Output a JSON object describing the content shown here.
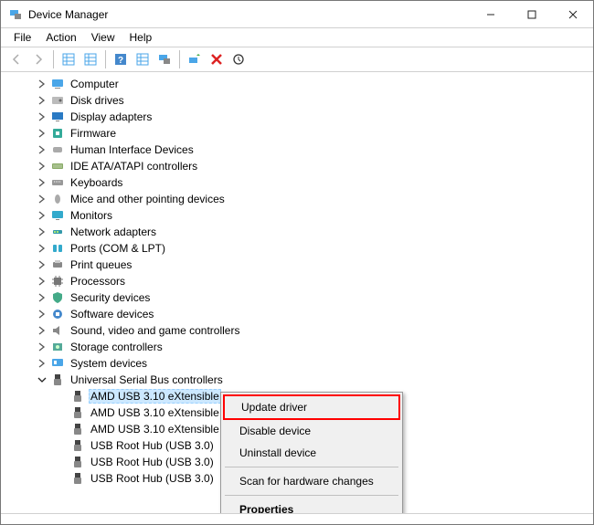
{
  "window": {
    "title": "Device Manager"
  },
  "menubar": {
    "file": "File",
    "action": "Action",
    "view": "View",
    "help": "Help"
  },
  "toolbar": {
    "back": "back",
    "forward": "forward",
    "showhide": "showhide",
    "properties": "properties",
    "help": "help",
    "details": "details",
    "devices": "devices",
    "scan": "scan",
    "remove": "remove",
    "more": "more"
  },
  "tree": {
    "nodes": [
      {
        "icon": "computer",
        "label": "Computer"
      },
      {
        "icon": "disk",
        "label": "Disk drives"
      },
      {
        "icon": "display",
        "label": "Display adapters"
      },
      {
        "icon": "firmware",
        "label": "Firmware"
      },
      {
        "icon": "hid",
        "label": "Human Interface Devices"
      },
      {
        "icon": "ide",
        "label": "IDE ATA/ATAPI controllers"
      },
      {
        "icon": "keyboard",
        "label": "Keyboards"
      },
      {
        "icon": "mouse",
        "label": "Mice and other pointing devices"
      },
      {
        "icon": "monitor",
        "label": "Monitors"
      },
      {
        "icon": "network",
        "label": "Network adapters"
      },
      {
        "icon": "port",
        "label": "Ports (COM & LPT)"
      },
      {
        "icon": "printer",
        "label": "Print queues"
      },
      {
        "icon": "cpu",
        "label": "Processors"
      },
      {
        "icon": "security",
        "label": "Security devices"
      },
      {
        "icon": "software",
        "label": "Software devices"
      },
      {
        "icon": "sound",
        "label": "Sound, video and game controllers"
      },
      {
        "icon": "storage",
        "label": "Storage controllers"
      },
      {
        "icon": "system",
        "label": "System devices"
      }
    ],
    "usb_parent": {
      "icon": "usb",
      "label": "Universal Serial Bus controllers"
    },
    "usb_children": [
      {
        "icon": "usb",
        "label": "AMD USB 3.10 eXtensible",
        "selected": true
      },
      {
        "icon": "usb",
        "label": "AMD USB 3.10 eXtensible"
      },
      {
        "icon": "usb",
        "label": "AMD USB 3.10 eXtensible"
      },
      {
        "icon": "usb",
        "label": "USB Root Hub (USB 3.0)"
      },
      {
        "icon": "usb",
        "label": "USB Root Hub (USB 3.0)"
      },
      {
        "icon": "usb",
        "label": "USB Root Hub (USB 3.0)"
      }
    ]
  },
  "context_menu": {
    "update": "Update driver",
    "disable": "Disable device",
    "uninstall": "Uninstall device",
    "scan": "Scan for hardware changes",
    "properties": "Properties"
  }
}
